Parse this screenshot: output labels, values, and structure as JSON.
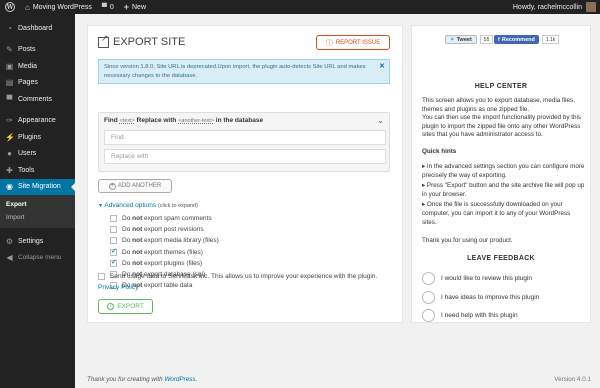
{
  "adminbar": {
    "site_name": "Moving WordPress",
    "comments_count": "0",
    "new_label": "New",
    "howdy": "Howdy, rachelmccollin"
  },
  "sidebar": {
    "items": [
      {
        "label": "Dashboard",
        "icon": "dashboard-icon"
      },
      {
        "label": "Posts",
        "icon": "pin-icon"
      },
      {
        "label": "Media",
        "icon": "media-icon"
      },
      {
        "label": "Pages",
        "icon": "pages-icon"
      },
      {
        "label": "Comments",
        "icon": "comments-icon"
      },
      {
        "label": "Appearance",
        "icon": "brush-icon"
      },
      {
        "label": "Plugins",
        "icon": "plug-icon"
      },
      {
        "label": "Users",
        "icon": "users-icon"
      },
      {
        "label": "Tools",
        "icon": "wrench-icon"
      },
      {
        "label": "Site Migration",
        "icon": "migration-icon"
      },
      {
        "label": "Settings",
        "icon": "settings-icon"
      },
      {
        "label": "Collapse menu",
        "icon": "collapse-icon"
      }
    ],
    "submenu": [
      "Export",
      "Import"
    ]
  },
  "main": {
    "title": "EXPORT SITE",
    "report_issue": "REPORT ISSUE",
    "notice": "Since version 1.8.0, Site URL is deprecated.Upon import, the plugin auto-detects Site URL and makes necessary changes to the database.",
    "find": {
      "find_word": "Find",
      "text_ph1": "<text>",
      "replace_word": "Replace with",
      "text_ph2": "<another-text>",
      "in_db": "in the database",
      "find_placeholder": "Find",
      "replace_placeholder": "Replace with"
    },
    "add_another": "ADD ANOTHER",
    "advanced": "Advanced options",
    "advanced_hint": "(click to expand)",
    "options": [
      {
        "rest": "export spam comments",
        "checked": false
      },
      {
        "rest": "export post revisions",
        "checked": false
      },
      {
        "rest": "export media library (files)",
        "checked": false
      },
      {
        "rest": "export themes (files)",
        "checked": true
      },
      {
        "rest": "export plugins (files)",
        "checked": true
      },
      {
        "rest": "export database (sql)",
        "checked": false
      },
      {
        "rest": "export table data",
        "checked": false
      }
    ],
    "do_word": "Do",
    "not_word": "not",
    "usage": "Send usage data to ServMask Inc. This allows us to improve your experience with the plugin.",
    "privacy": "Privacy Policy",
    "export": "EXPORT"
  },
  "help": {
    "tweet": "Tweet",
    "tweet_count": "55",
    "recommend": "Recommend",
    "recommend_count": "1.1k",
    "title": "HELP CENTER",
    "intro": "This screen allows you to export database, media files, themes and plugins as one zipped file.",
    "intro2": "You can then use the import functionality provided by this plugin to import the zipped file onto any other WordPress sites that you have administrator access to.",
    "quick": "Quick hints",
    "hints": [
      "In the advanced settings section you can configure more precisely the way of exporting.",
      "Press \"Export\" button and the site archive file will pop up in your browser.",
      "Once the file is successfully downloaded on your computer, you can import it to any of your WordPress sites."
    ],
    "thanks": "Thank you for using our product.",
    "feedback_title": "LEAVE FEEDBACK",
    "feedback": [
      "I would like to review this plugin",
      "I have ideas to improve this plugin",
      "I need help with this plugin"
    ]
  },
  "footer": {
    "thanks_pre": "Thank you for creating with",
    "wordpress": "WordPress",
    "version": "Version 4.0.1"
  },
  "colors": {
    "accent": "#0074a2",
    "report": "#d54e21",
    "export": "#5cb85c"
  }
}
